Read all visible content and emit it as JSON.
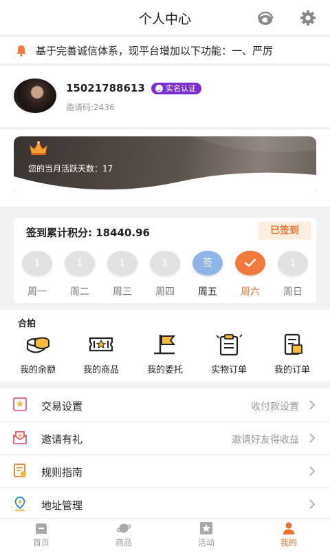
{
  "header": {
    "title": "个人中心",
    "status_fragment": "···"
  },
  "notice": {
    "text": "基于完善诚信体系，现平台增加以下功能：一、严厉"
  },
  "profile": {
    "phone": "15021788613",
    "verify_badge": "实名认证",
    "invite_code": "邀请码:2436"
  },
  "activity": {
    "text": "您的当月活跃天数：17"
  },
  "signin": {
    "total_label": "签到累计积分: 18440.96",
    "button_label": "已签到",
    "days": [
      {
        "value": "1",
        "label": "周一",
        "state": "normal"
      },
      {
        "value": "1",
        "label": "周二",
        "state": "normal"
      },
      {
        "value": "1",
        "label": "周三",
        "state": "normal"
      },
      {
        "value": "1",
        "label": "周四",
        "state": "normal"
      },
      {
        "value": "签",
        "label": "周五",
        "state": "today"
      },
      {
        "value": "",
        "label": "周六",
        "state": "checked"
      },
      {
        "value": "1",
        "label": "周日",
        "state": "normal"
      }
    ]
  },
  "hepai": {
    "title": "合拍",
    "items": [
      {
        "label": "我的余额",
        "icon": "balance-icon"
      },
      {
        "label": "我的商品",
        "icon": "ticket-icon"
      },
      {
        "label": "我的委托",
        "icon": "flag-icon"
      },
      {
        "label": "实物订单",
        "icon": "clipboard-icon"
      },
      {
        "label": "我的订单",
        "icon": "order-icon"
      }
    ]
  },
  "menu": [
    {
      "title": "交易设置",
      "subtitle": "收付款设置",
      "icon": "trade-settings-icon"
    },
    {
      "title": "邀请有礼",
      "subtitle": "邀请好友得收益",
      "icon": "invite-gift-icon"
    },
    {
      "title": "规则指南",
      "subtitle": "",
      "icon": "rules-icon"
    },
    {
      "title": "地址管理",
      "subtitle": "",
      "icon": "location-icon"
    }
  ],
  "tabbar": [
    {
      "label": "首页",
      "icon": "home-icon",
      "active": false
    },
    {
      "label": "商品",
      "icon": "planet-icon",
      "active": false
    },
    {
      "label": "活动",
      "icon": "star-icon",
      "active": false
    },
    {
      "label": "我的",
      "icon": "user-icon",
      "active": true
    }
  ],
  "colors": {
    "accent": "#e8722e",
    "badge": "#7b2fd0",
    "today": "#8fb4e8"
  }
}
